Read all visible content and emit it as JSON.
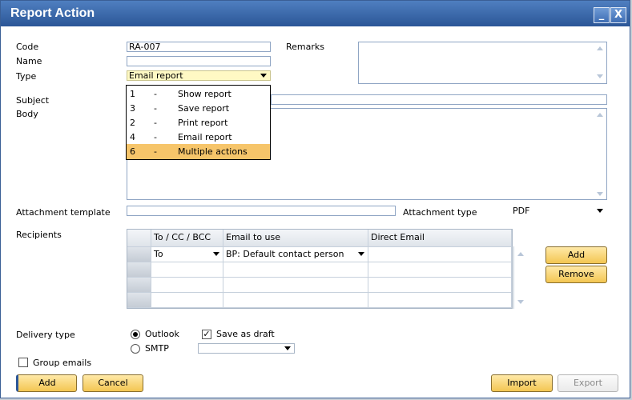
{
  "window": {
    "title": "Report Action",
    "minimize": "_",
    "close": "X"
  },
  "form": {
    "code_label": "Code",
    "code_value": "RA-007",
    "name_label": "Name",
    "name_value": "",
    "type_label": "Type",
    "type_value": "Email report",
    "remarks_label": "Remarks",
    "subject_label": "Subject",
    "body_label": "Body",
    "attachment_template_label": "Attachment template",
    "attachment_type_label": "Attachment type",
    "attachment_type_value": "PDF",
    "recipients_label": "Recipients",
    "delivery_type_label": "Delivery type",
    "outlook_label": "Outlook",
    "smtp_label": "SMTP",
    "save_as_draft_label": "Save as draft",
    "group_emails_label": "Group emails"
  },
  "type_dropdown": {
    "items": [
      {
        "code": "1",
        "sep": "-",
        "label": "Show report"
      },
      {
        "code": "3",
        "sep": "-",
        "label": "Save report"
      },
      {
        "code": "2",
        "sep": "-",
        "label": "Print report"
      },
      {
        "code": "4",
        "sep": "-",
        "label": "Email report"
      },
      {
        "code": "6",
        "sep": "-",
        "label": "Multiple actions"
      }
    ]
  },
  "grid": {
    "headers": [
      "To / CC / BCC",
      "Email to use",
      "Direct Email"
    ],
    "rows": [
      {
        "to": "To",
        "email": "BP: Default contact person",
        "direct": ""
      }
    ]
  },
  "buttons": {
    "add_recipient": "Add",
    "remove_recipient": "Remove",
    "add": "Add",
    "cancel": "Cancel",
    "import": "Import",
    "export": "Export"
  },
  "state": {
    "outlook_selected": true,
    "smtp_selected": false,
    "save_as_draft": true,
    "group_emails": false,
    "export_enabled": false
  },
  "colors": {
    "title_bar": "#2b5697",
    "button": "#f3c652",
    "highlight": "#f6c56a",
    "remarks_bg": "#fff9c4"
  }
}
